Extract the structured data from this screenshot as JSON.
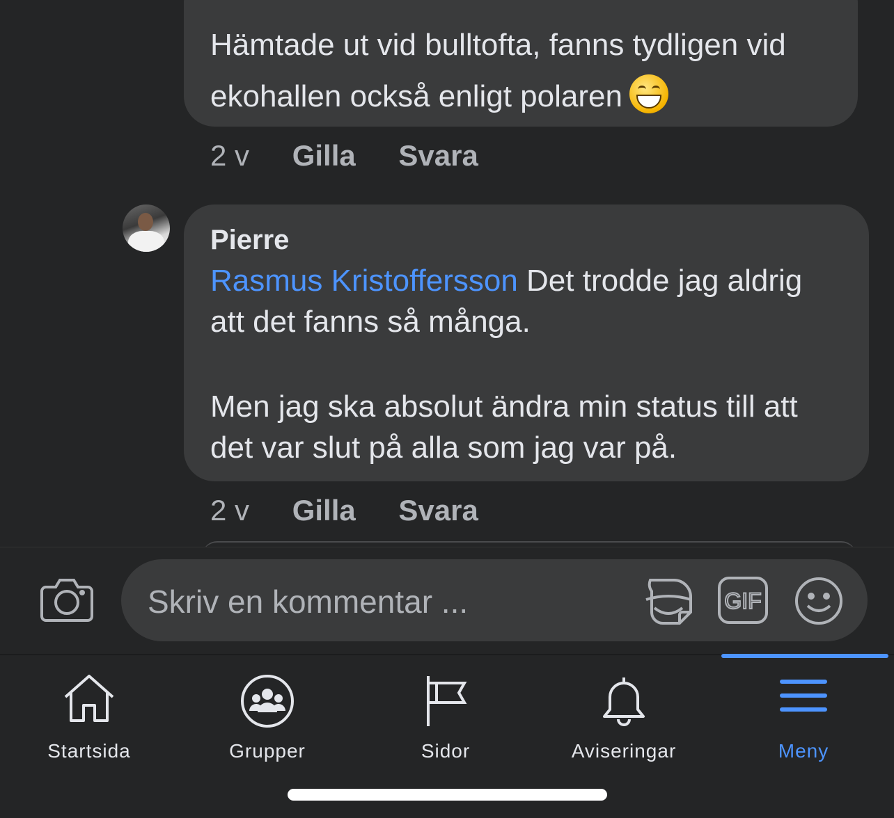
{
  "comments": [
    {
      "text": "Hämtade ut vid bulltofta, fanns tydligen vid ekohallen också enligt polaren",
      "emoji": "grinning-face-emoji",
      "time": "2 v",
      "like_label": "Gilla",
      "reply_label": "Svara"
    },
    {
      "author": "Pierre",
      "mention": "Rasmus Kristoffersson",
      "text_line1": " Det trodde jag aldrig att det fanns så många.",
      "text_line2": "Men jag ska absolut ändra min status till att det var slut på alla som jag var på.",
      "time": "2 v",
      "like_label": "Gilla",
      "reply_label": "Svara"
    }
  ],
  "composer": {
    "placeholder": "Skriv en kommentar ...",
    "icons": [
      "camera-icon",
      "sticker-icon",
      "gif-icon",
      "emoji-icon"
    ]
  },
  "tabbar": {
    "active_color": "#4d94ff",
    "tabs": [
      {
        "label": "Startsida",
        "icon": "home-icon"
      },
      {
        "label": "Grupper",
        "icon": "groups-icon"
      },
      {
        "label": "Sidor",
        "icon": "flag-icon"
      },
      {
        "label": "Aviseringar",
        "icon": "bell-icon"
      },
      {
        "label": "Meny",
        "icon": "menu-icon",
        "active": true
      }
    ]
  }
}
